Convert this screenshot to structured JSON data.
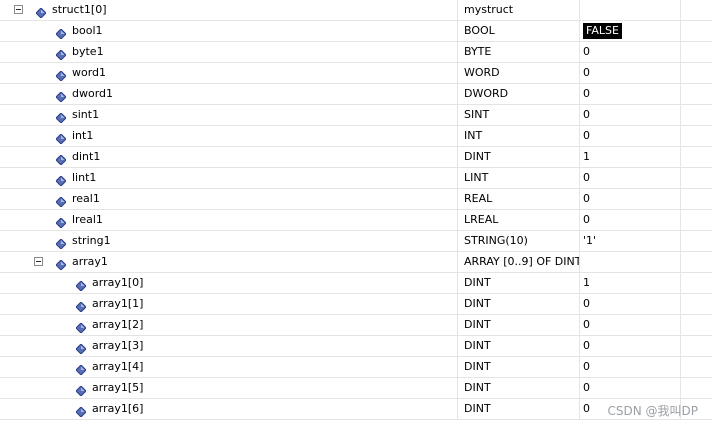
{
  "rows": [
    {
      "name": "struct1[0]",
      "type": "mystruct",
      "value": "",
      "level": 0,
      "expander": true
    },
    {
      "name": "bool1",
      "type": "BOOL",
      "value": "FALSE",
      "level": 1,
      "selected": true
    },
    {
      "name": "byte1",
      "type": "BYTE",
      "value": "0",
      "level": 1
    },
    {
      "name": "word1",
      "type": "WORD",
      "value": "0",
      "level": 1
    },
    {
      "name": "dword1",
      "type": "DWORD",
      "value": "0",
      "level": 1
    },
    {
      "name": "sint1",
      "type": "SINT",
      "value": "0",
      "level": 1
    },
    {
      "name": "int1",
      "type": "INT",
      "value": "0",
      "level": 1
    },
    {
      "name": "dint1",
      "type": "DINT",
      "value": "1",
      "level": 1
    },
    {
      "name": "lint1",
      "type": "LINT",
      "value": "0",
      "level": 1
    },
    {
      "name": "real1",
      "type": "REAL",
      "value": "0",
      "level": 1
    },
    {
      "name": "lreal1",
      "type": "LREAL",
      "value": "0",
      "level": 1
    },
    {
      "name": "string1",
      "type": "STRING(10)",
      "value": "'1'",
      "level": 1
    },
    {
      "name": "array1",
      "type": "ARRAY [0..9] OF DINT",
      "value": "",
      "level": 1,
      "expander": true
    },
    {
      "name": "array1[0]",
      "type": "DINT",
      "value": "1",
      "level": 2
    },
    {
      "name": "array1[1]",
      "type": "DINT",
      "value": "0",
      "level": 2
    },
    {
      "name": "array1[2]",
      "type": "DINT",
      "value": "0",
      "level": 2
    },
    {
      "name": "array1[3]",
      "type": "DINT",
      "value": "0",
      "level": 2
    },
    {
      "name": "array1[4]",
      "type": "DINT",
      "value": "0",
      "level": 2
    },
    {
      "name": "array1[5]",
      "type": "DINT",
      "value": "0",
      "level": 2
    },
    {
      "name": "array1[6]",
      "type": "DINT",
      "value": "0",
      "level": 2
    }
  ],
  "icon": "variable-icon",
  "colors": {
    "icon_fill": "#5a6fb4",
    "icon_dark": "#2a3f8a",
    "grid": "#e4e4e4"
  },
  "watermark": "CSDN @我叫DP"
}
